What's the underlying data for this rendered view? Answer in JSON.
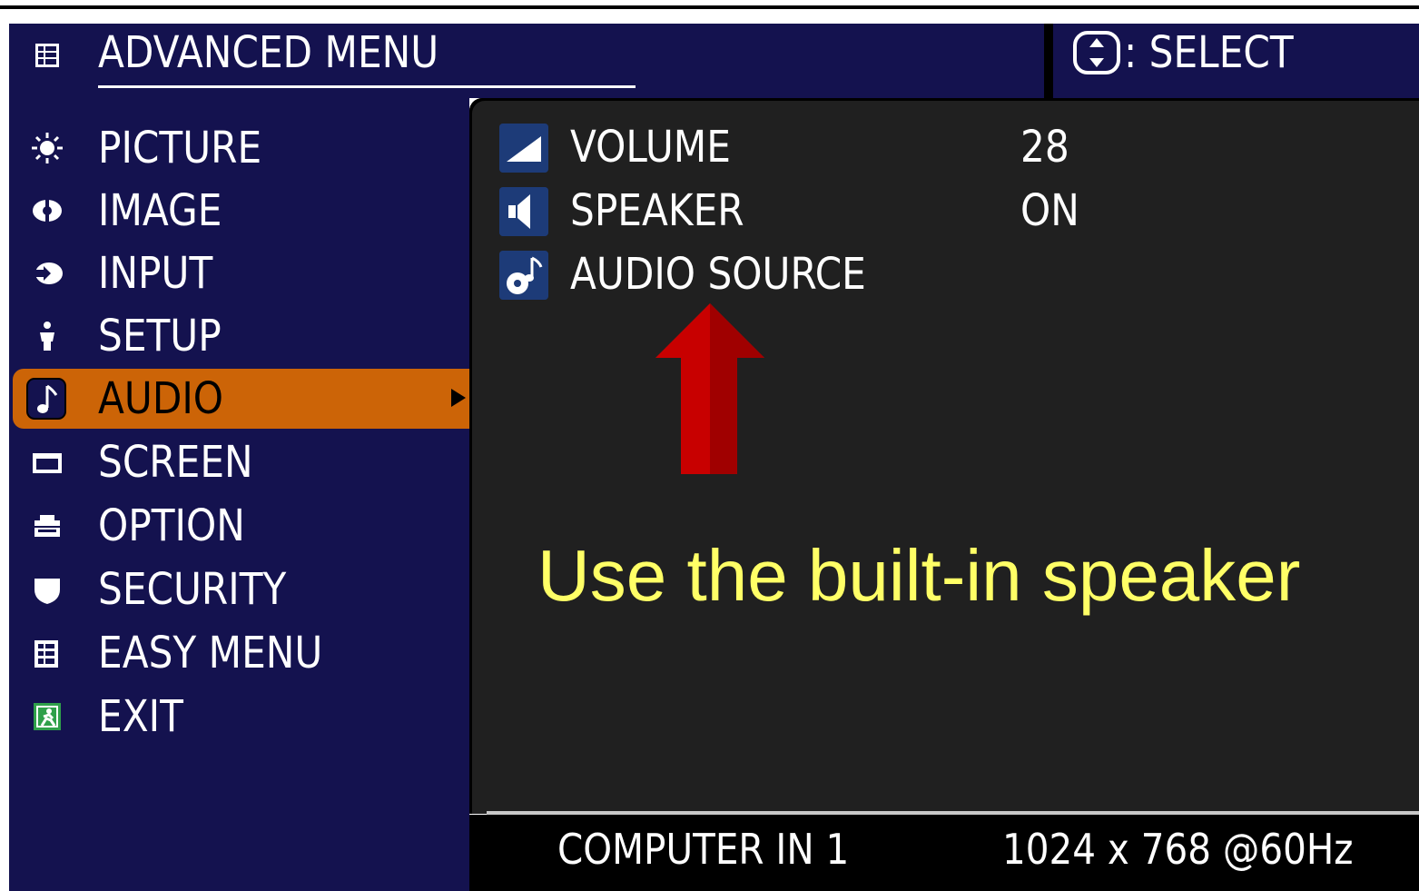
{
  "header": {
    "title": "ADVANCED MENU",
    "title_icon": "menu-grid-icon",
    "select_icon": "dpad-icon",
    "select_label": ": SELECT"
  },
  "sidebar": {
    "items": [
      {
        "label": "PICTURE",
        "icon": "brightness-icon",
        "active": false
      },
      {
        "label": "IMAGE",
        "icon": "image-adjust-icon",
        "active": false
      },
      {
        "label": "INPUT",
        "icon": "input-icon",
        "active": false
      },
      {
        "label": "SETUP",
        "icon": "setup-icon",
        "active": false
      },
      {
        "label": "AUDIO",
        "icon": "music-note-icon",
        "active": true
      },
      {
        "label": "SCREEN",
        "icon": "screen-icon",
        "active": false
      },
      {
        "label": "OPTION",
        "icon": "option-icon",
        "active": false
      },
      {
        "label": "SECURITY",
        "icon": "shield-icon",
        "active": false
      },
      {
        "label": "EASY MENU",
        "icon": "easy-menu-icon",
        "active": false
      },
      {
        "label": "EXIT",
        "icon": "exit-icon",
        "active": false
      }
    ]
  },
  "panel": {
    "rows": [
      {
        "label": "VOLUME",
        "value": "28",
        "icon": "volume-icon"
      },
      {
        "label": "SPEAKER",
        "value": "ON",
        "icon": "speaker-icon"
      },
      {
        "label": "AUDIO SOURCE",
        "value": "",
        "icon": "audio-source-icon"
      }
    ]
  },
  "annotation": {
    "text": "Use the built-in speaker"
  },
  "status": {
    "input": "COMPUTER IN 1",
    "resolution": "1024 x 768 @60Hz"
  },
  "colors": {
    "menu_bg": "#14124f",
    "panel_bg": "#202020",
    "active_item": "#cc6407",
    "annotation_text": "#ffff66",
    "arrow": "#cc0000"
  }
}
